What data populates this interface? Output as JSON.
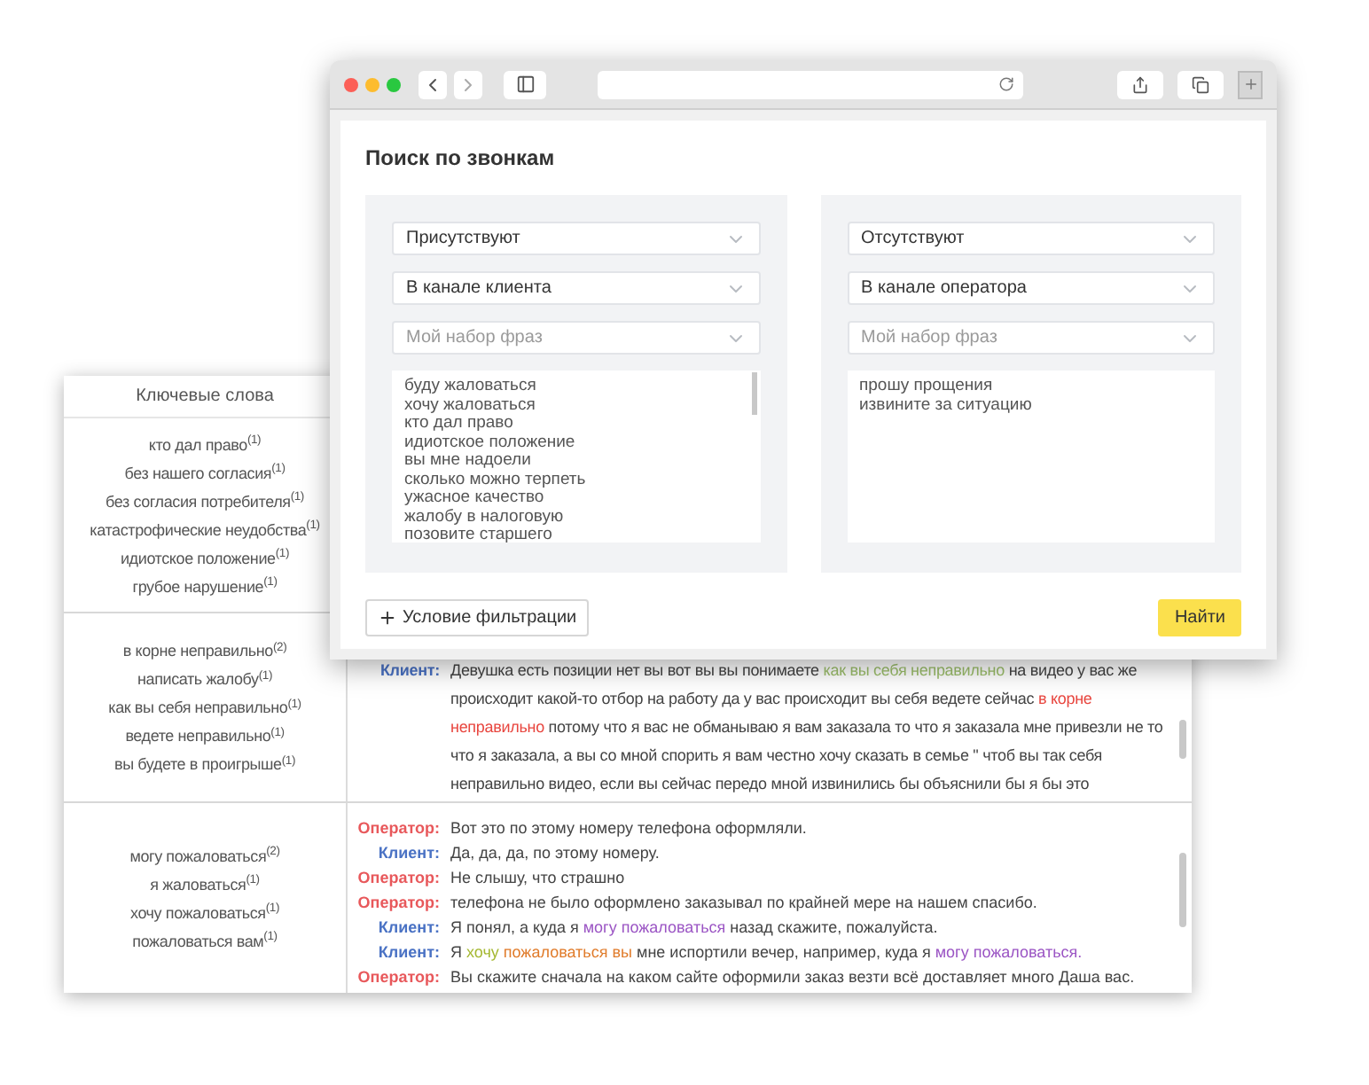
{
  "results": {
    "header": "Ключевые слова",
    "rows": [
      {
        "keywords": [
          "кто дал право$^{(1)}$",
          "без нашего согласия$^{(1)}$",
          "без согласия потребителя$^{(1)}$",
          "катастрофические неудобства$^{(1)}$",
          "идиотское положение$^{(1)}$",
          "грубое нарушение$^{(1)}$"
        ],
        "transcript": []
      },
      {
        "keywords": [
          "в корне неправильно$^{(2)}$",
          "написать жалобу$^{(1)}$",
          "как вы себя неправильно$^{(1)}$",
          "ведете неправильно$^{(1)}$",
          "вы будете в проигрыше$^{(1)}$"
        ],
        "transcript": [
          {
            "speaker": "Клиент:",
            "kind": "client",
            "segments": [
              {
                "text": "Девушка есть позиции нет вы вот вы вы понимаете "
              },
              {
                "text": "как вы себя неправильно",
                "color": "#9cbf6b"
              },
              {
                "text": " на видео у вас же происходит какой-то отбор на работу да у вас происходит вы себя ведете сейчас "
              },
              {
                "text": "в корне неправильно",
                "color": "#e8463f"
              },
              {
                "text": " потому что я вас не обманываю я вам заказала то что я заказала мне привезли не то что я заказала, а вы со мной спорить я вам честно хочу сказать в семье \" чтоб вы так себя неправильно видео, если вы сейчас передо мной извинились бы объяснили бы я бы это"
              }
            ]
          }
        ]
      },
      {
        "keywords": [
          "могу пожаловаться$^{(2)}$",
          "я жаловаться$^{(1)}$",
          "хочу пожаловаться$^{(1)}$",
          "пожаловаться вам$^{(1)}$"
        ],
        "transcript": [
          {
            "speaker": "Оператор:",
            "kind": "operator",
            "segments": [
              {
                "text": "Вот это по этому номеру телефона оформляли."
              }
            ]
          },
          {
            "speaker": "Клиент:",
            "kind": "client",
            "segments": [
              {
                "text": "Да, да, да, по этому номеру."
              }
            ]
          },
          {
            "speaker": "Оператор:",
            "kind": "operator",
            "segments": [
              {
                "text": "Не слышу, что страшно"
              }
            ]
          },
          {
            "speaker": "Оператор:",
            "kind": "operator",
            "segments": [
              {
                "text": "телефона не было оформлено заказывал по крайней мере на нашем спасибо."
              }
            ]
          },
          {
            "speaker": "Клиент:",
            "kind": "client",
            "segments": [
              {
                "text": "Я понял, а куда я "
              },
              {
                "text": "могу пожаловаться",
                "color": "#9b55c4"
              },
              {
                "text": " назад скажите, пожалуйста."
              }
            ]
          },
          {
            "speaker": "Клиент:",
            "kind": "client",
            "segments": [
              {
                "text": "Я "
              },
              {
                "text": "хочу",
                "color": "#a5b832"
              },
              {
                "text": " пожаловаться вы",
                "color": "#e07b2a"
              },
              {
                "text": " мне испортили вечер, например, куда я "
              },
              {
                "text": "могу пожаловаться.",
                "color": "#9b55c4"
              }
            ]
          },
          {
            "speaker": "Оператор:",
            "kind": "operator",
            "segments": [
              {
                "text": "Вы скажите сначала на каком сайте оформили заказ везти всё доставляет много Даша вас."
              }
            ]
          }
        ]
      }
    ]
  },
  "search": {
    "title": "Поиск по звонкам",
    "conditions": [
      {
        "presence": "Присутствуют",
        "channel": "В канале клиента",
        "phrase_set": {
          "placeholder": "Мой набор фраз"
        },
        "phrases": [
          "буду жаловаться",
          "хочу жаловаться",
          "кто дал право",
          "идиотское положение",
          "вы мне надоели",
          "сколько можно терпеть",
          "ужасное качество",
          "жалобу в налоговую",
          "позовите старшего"
        ]
      },
      {
        "presence": "Отсутствуют",
        "channel": "В канале оператора",
        "phrase_set": {
          "placeholder": "Мой набор фраз"
        },
        "phrases": [
          "прошу прощения",
          "извините за ситуацию"
        ]
      }
    ],
    "add_button": "Условие фильтрации",
    "find_button": "Найти"
  }
}
